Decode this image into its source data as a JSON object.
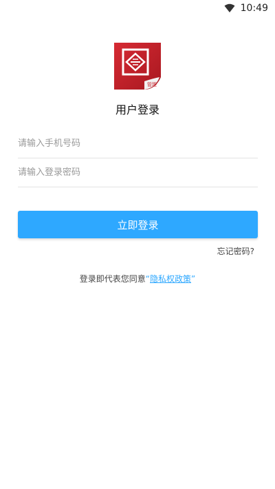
{
  "status_bar": {
    "time": "10:49",
    "wifi_icon": "wifi-icon"
  },
  "logo": {
    "badge_text": "管理",
    "primary_color": "#c8232c"
  },
  "title": "用户登录",
  "form": {
    "phone_placeholder": "请输入手机号码",
    "phone_value": "",
    "password_placeholder": "请输入登录密码",
    "password_value": ""
  },
  "login_button_label": "立即登录",
  "forgot_password_label": "忘记密码?",
  "agreement": {
    "prefix": "登录即代表您同意",
    "open_quote": "“",
    "policy_label": "隐私权政策",
    "close_quote": "”"
  },
  "colors": {
    "accent": "#2ea8ff",
    "brand_red": "#c8232c"
  }
}
